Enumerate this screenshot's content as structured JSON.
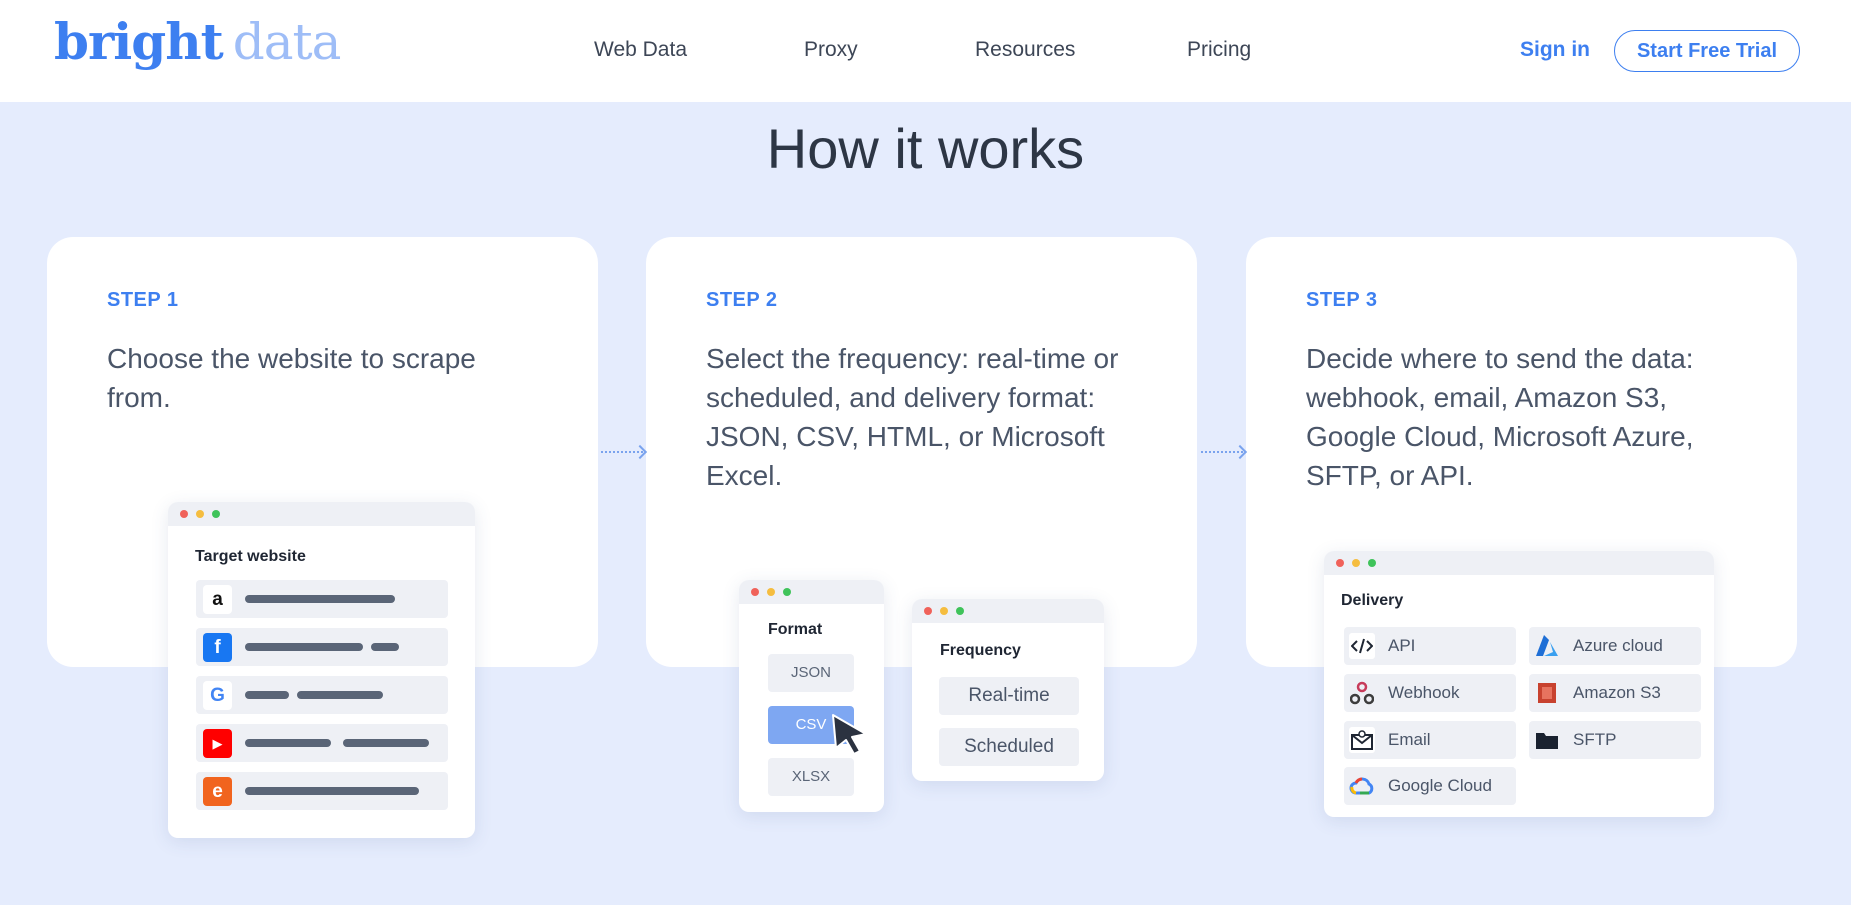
{
  "header": {
    "logo": {
      "word1": "bright",
      "word2": "data"
    },
    "nav": [
      "Web Data",
      "Proxy",
      "Resources",
      "Pricing"
    ],
    "sign_in": "Sign in",
    "trial_button": "Start Free Trial"
  },
  "title": "How it works",
  "steps": [
    {
      "label": "STEP 1",
      "text": "Choose the website to scrape from."
    },
    {
      "label": "STEP 2",
      "text": "Select the frequency: real-time or scheduled, and delivery format: JSON, CSV, HTML, or Microsoft Excel."
    },
    {
      "label": "STEP 3",
      "text": "Decide where to send the data: webhook, email, Amazon S3, Google Cloud, Microsoft Azure, SFTP, or API."
    }
  ],
  "target_window": {
    "title": "Target website",
    "sites": [
      {
        "icon": "amazon-icon",
        "glyph": "a",
        "color": "#111111"
      },
      {
        "icon": "facebook-icon",
        "glyph": "f",
        "color": "#1877f2"
      },
      {
        "icon": "google-icon",
        "glyph": "G",
        "color": "#4285f4"
      },
      {
        "icon": "youtube-icon",
        "glyph": "▶",
        "color": "#ff0000"
      },
      {
        "icon": "etsy-icon",
        "glyph": "e",
        "color": "#f1641e"
      }
    ]
  },
  "format_window": {
    "title": "Format",
    "options": [
      "JSON",
      "CSV",
      "XLSX"
    ],
    "selected": "CSV"
  },
  "frequency_window": {
    "title": "Frequency",
    "options": [
      "Real-time",
      "Scheduled"
    ]
  },
  "delivery_window": {
    "title": "Delivery",
    "options": [
      {
        "label": "API",
        "icon": "code-icon"
      },
      {
        "label": "Azure cloud",
        "icon": "azure-icon"
      },
      {
        "label": "Webhook",
        "icon": "webhook-icon"
      },
      {
        "label": "Amazon S3",
        "icon": "s3-icon"
      },
      {
        "label": "Email",
        "icon": "email-icon"
      },
      {
        "label": "SFTP",
        "icon": "folder-icon"
      },
      {
        "label": "Google Cloud",
        "icon": "google-cloud-icon"
      }
    ]
  },
  "colors": {
    "accent": "#3d7ff0",
    "page_bg": "#e5ecfd",
    "selected_format": "#7ea7f2"
  }
}
